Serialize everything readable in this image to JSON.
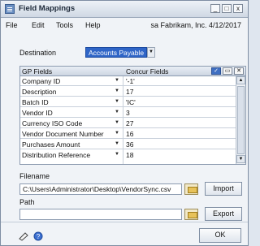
{
  "window": {
    "title": "Field Mappings",
    "controls": {
      "minimize": "_",
      "maximize": "□",
      "close": "x"
    }
  },
  "menu": {
    "items": [
      "File",
      "Edit",
      "Tools",
      "Help"
    ]
  },
  "header": {
    "company_info": "sa  Fabrikam, Inc.  4/12/2017"
  },
  "destination": {
    "label": "Destination",
    "value": "Accounts Payable"
  },
  "grid": {
    "columns": [
      "GP Fields",
      "Concur Fields"
    ],
    "rows": [
      {
        "gp": "Company ID",
        "concur": "'-1'"
      },
      {
        "gp": "Description",
        "concur": "17"
      },
      {
        "gp": "Batch ID",
        "concur": "'IC'"
      },
      {
        "gp": "Vendor ID",
        "concur": "3"
      },
      {
        "gp": "Currency ISO Code",
        "concur": "27"
      },
      {
        "gp": "Vendor Document Number",
        "concur": "16"
      },
      {
        "gp": "Purchases Amount",
        "concur": "36"
      },
      {
        "gp": "Distribution Reference",
        "concur": "18"
      }
    ]
  },
  "filename": {
    "label": "Filename",
    "value": "C:\\Users\\Administrator\\Desktop\\VendorSync.csv",
    "button": "Import"
  },
  "path": {
    "label": "Path",
    "value": "",
    "button": "Export"
  },
  "footer": {
    "ok_label": "OK"
  },
  "colors": {
    "selection": "#2f65c7",
    "window_bg": "#f0f3f7"
  },
  "icons": [
    "field-mappings-app-icon",
    "folder-icon",
    "note-icon",
    "help-icon",
    "expand-icon",
    "note-icon",
    "delete-icon"
  ]
}
